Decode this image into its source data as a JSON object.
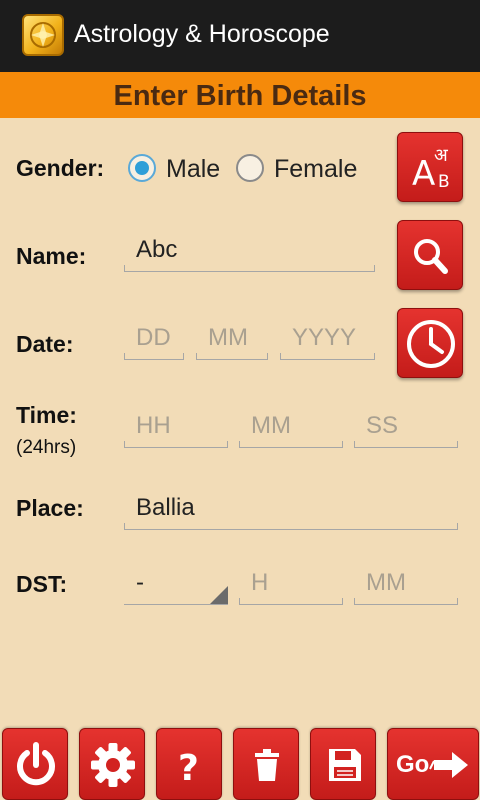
{
  "app": {
    "title": "Astrology & Horoscope",
    "logo_icon": "app-logo-icon"
  },
  "section": {
    "title": "Enter Birth Details"
  },
  "colors": {
    "appbar": "#1c1c1c",
    "section_bar": "#f58a0a",
    "background": "#f2dcb7",
    "button_red": "#d72422",
    "radio_selected": "#2f9fd8"
  },
  "form": {
    "gender": {
      "label": "Gender:",
      "options": [
        "Male",
        "Female"
      ],
      "selected": "Male"
    },
    "name": {
      "label": "Name:",
      "value": "Abc"
    },
    "date": {
      "label": "Date:",
      "day_placeholder": "DD",
      "month_placeholder": "MM",
      "year_placeholder": "YYYY"
    },
    "time": {
      "label": "Time:",
      "sublabel": "(24hrs)",
      "hour_placeholder": "HH",
      "minute_placeholder": "MM",
      "second_placeholder": "SS"
    },
    "place": {
      "label": "Place:",
      "value": "Ballia"
    },
    "dst": {
      "label": "DST:",
      "selected": "-",
      "hour_placeholder": "H",
      "minute_placeholder": "MM"
    }
  },
  "side_buttons": [
    {
      "name": "language-button",
      "icon": "language-icon"
    },
    {
      "name": "search-button",
      "icon": "search-icon"
    },
    {
      "name": "current-time-button",
      "icon": "clock-icon"
    }
  ],
  "language_icon_glyphs": {
    "top": "अ",
    "big": "A",
    "small": "B"
  },
  "bottom_buttons": [
    {
      "name": "power-button",
      "icon": "power-icon"
    },
    {
      "name": "settings-button",
      "icon": "gear-icon"
    },
    {
      "name": "help-button",
      "icon": "question-icon"
    },
    {
      "name": "delete-button",
      "icon": "trash-icon"
    },
    {
      "name": "save-button",
      "icon": "save-icon"
    },
    {
      "name": "go-button",
      "icon": "arrow-right-icon",
      "label": "Go"
    }
  ]
}
